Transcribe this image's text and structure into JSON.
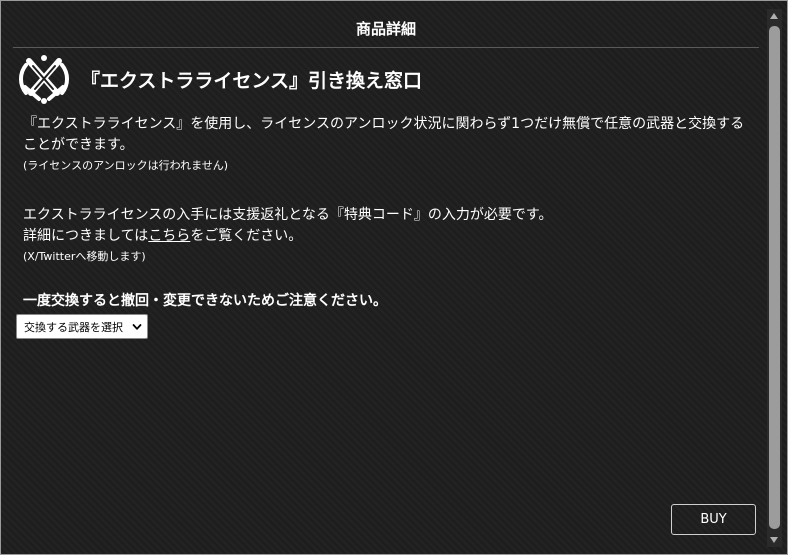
{
  "header": {
    "title": "商品詳細"
  },
  "page": {
    "emblem_icon": "crossed-swords-emblem-icon",
    "title": "『エクストラライセンス』引き換え窓口"
  },
  "content": {
    "paragraph1": "『エクストラライセンス』を使用し、ライセンスのアンロック状況に関わらず1つだけ無償で任意の武器と交換することができます。",
    "note1": "(ライセンスのアンロックは行われません)",
    "paragraph2_line1": "エクストラライセンスの入手には支援返礼となる『特典コード』の入力が必要です。",
    "paragraph2_line2_prefix": "詳細につきましては",
    "paragraph2_link": "こちら",
    "paragraph2_line2_suffix": "をご覧ください。",
    "note2": "(X/Twitterへ移動します)",
    "warning": "一度交換すると撤回・変更できないためご注意ください。"
  },
  "weapon_select": {
    "selected": "交換する武器を選択",
    "icon": "chevron-down-icon"
  },
  "buy_button": {
    "label": "BUY"
  },
  "colors": {
    "background": "#1e1e1e",
    "text": "#ffffff",
    "divider": "#5a5a5a",
    "scrollbar_thumb": "#9c9c9c"
  }
}
